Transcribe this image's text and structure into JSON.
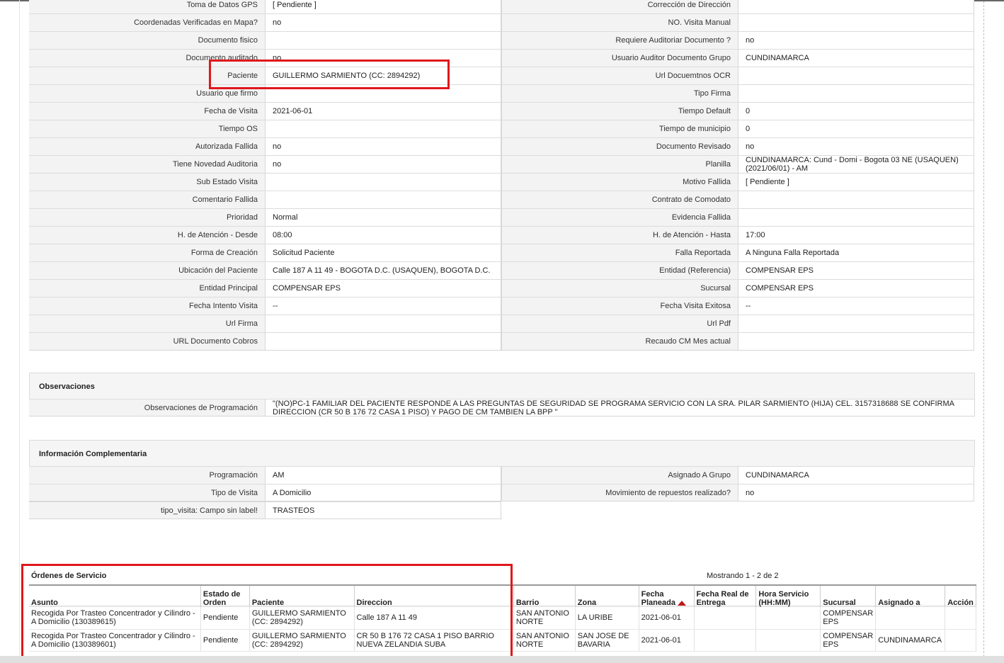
{
  "details": [
    {
      "l_label": "Toma de Datos GPS",
      "l_value": "[ Pendiente ]",
      "r_label": "Corrección de Dirección",
      "r_value": ""
    },
    {
      "l_label": "Coordenadas Verificadas en Mapa?",
      "l_value": "no",
      "r_label": "NO. Visita Manual",
      "r_value": ""
    },
    {
      "l_label": "Documento fisico",
      "l_value": "",
      "r_label": "Requiere Auditoriar Documento ?",
      "r_value": "no"
    },
    {
      "l_label": "Documento auditado",
      "l_value": "no",
      "r_label": "Usuario Auditor Documento Grupo",
      "r_value": "CUNDINAMARCA"
    },
    {
      "l_label": "Paciente",
      "l_value": "GUILLERMO SARMIENTO (CC: 2894292)",
      "r_label": "Url Docuemtnos OCR",
      "r_value": ""
    },
    {
      "l_label": "Usuario que firmo",
      "l_value": "",
      "r_label": "Tipo Firma",
      "r_value": ""
    },
    {
      "l_label": "Fecha de Visita",
      "l_value": "2021-06-01",
      "r_label": "Tiempo Default",
      "r_value": "0"
    },
    {
      "l_label": "Tiempo OS",
      "l_value": "",
      "r_label": "Tiempo de municipio",
      "r_value": "0"
    },
    {
      "l_label": "Autorizada Fallida",
      "l_value": "no",
      "r_label": "Documento Revisado",
      "r_value": "no"
    },
    {
      "l_label": "Tiene Novedad Auditoria",
      "l_value": "no",
      "r_label": "Planilla",
      "r_value": "CUNDINAMARCA: Cund - Domi - Bogota 03 NE (USAQUEN) (2021/06/01) - AM"
    },
    {
      "l_label": "Sub Estado Visita",
      "l_value": "",
      "r_label": "Motivo Fallida",
      "r_value": "[ Pendiente ]"
    },
    {
      "l_label": "Comentario Fallida",
      "l_value": "",
      "r_label": "Contrato de Comodato",
      "r_value": ""
    },
    {
      "l_label": "Prioridad",
      "l_value": "Normal",
      "r_label": "Evidencia Fallida",
      "r_value": ""
    },
    {
      "l_label": "H. de Atención - Desde",
      "l_value": "08:00",
      "r_label": "H. de Atención - Hasta",
      "r_value": "17:00"
    },
    {
      "l_label": "Forma de Creación",
      "l_value": "Solicitud Paciente",
      "r_label": "Falla Reportada",
      "r_value": "A Ninguna Falla Reportada"
    },
    {
      "l_label": "Ubicación del Paciente",
      "l_value": "Calle 187 A 11 49 - BOGOTA D.C. (USAQUEN), BOGOTA D.C.",
      "r_label": "Entidad (Referencia)",
      "r_value": "COMPENSAR EPS"
    },
    {
      "l_label": "Entidad Principal",
      "l_value": "COMPENSAR EPS",
      "r_label": "Sucursal",
      "r_value": "COMPENSAR EPS"
    },
    {
      "l_label": "Fecha Intento Visita",
      "l_value": "--",
      "r_label": "Fecha Visita Exitosa",
      "r_value": "--"
    },
    {
      "l_label": "Url Firma",
      "l_value": "",
      "r_label": "Url Pdf",
      "r_value": ""
    },
    {
      "l_label": "URL Documento Cobros",
      "l_value": "",
      "r_label": "Recaudo CM Mes actual",
      "r_value": ""
    }
  ],
  "observaciones": {
    "title": "Observaciones",
    "label": "Observaciones de Programación",
    "value": "\"(NO)PC-1 FAMILIAR DEL PACIENTE RESPONDE A LAS PREGUNTAS DE SEGURIDAD SE PROGRAMA SERVICIO CON LA SRA. PILAR SARMIENTO (HIJA) CEL. 3157318688 SE CONFIRMA DIRECCION (CR 50 B 176 72 CASA 1 PISO) Y PAGO DE CM TAMBIEN LA BPP \""
  },
  "complementaria": {
    "title": "Información Complementaria",
    "rows": [
      {
        "l_label": "Programación",
        "l_value": "AM",
        "r_label": "Asignado A Grupo",
        "r_value": "CUNDINAMARCA"
      },
      {
        "l_label": "Tipo de Visita",
        "l_value": "A Domicilio",
        "r_label": "Movimiento de repuestos realizado?",
        "r_value": "no"
      },
      {
        "l_label": "tipo_visita: Campo sin label!",
        "l_value": "TRASTEOS"
      }
    ]
  },
  "orders": {
    "title": "Órdenes de Servicio",
    "count": "Mostrando 1 - 2 de 2",
    "columns": {
      "asunto": "Asunto",
      "estado": "Estado de Orden",
      "paciente": "Paciente",
      "direccion": "Direccion",
      "barrio": "Barrio",
      "zona": "Zona",
      "fecha_planeada": "Fecha Planeada",
      "fecha_real": "Fecha Real de Entrega",
      "hora_servicio": "Hora Servicio (HH:MM)",
      "sucursal": "Sucursal",
      "asignado": "Asignado a",
      "accion": "Acción"
    },
    "rows": [
      {
        "asunto": "Recogida Por Trasteo Concentrador y Cilindro - A Domicilio (130389615)",
        "estado": "Pendiente",
        "paciente": "GUILLERMO SARMIENTO (CC: 2894292)",
        "direccion": "Calle 187 A 11 49",
        "barrio": "SAN ANTONIO NORTE",
        "zona": "LA URIBE",
        "fecha_planeada": "2021-06-01",
        "fecha_real": "",
        "hora_servicio": "",
        "sucursal": "COMPENSAR EPS",
        "asignado": "",
        "accion": ""
      },
      {
        "asunto": "Recogida Por Trasteo Concentrador y Cilindro - A Domicilio (130389601)",
        "estado": "Pendiente",
        "paciente": "GUILLERMO SARMIENTO (CC: 2894292)",
        "direccion": "CR 50 B 176 72 CASA 1 PISO BARRIO NUEVA ZELANDIA SUBA",
        "barrio": "SAN ANTONIO NORTE",
        "zona": "SAN JOSE DE BAVARIA",
        "fecha_planeada": "2021-06-01",
        "fecha_real": "",
        "hora_servicio": "",
        "sucursal": "COMPENSAR EPS",
        "asignado": "CUNDINAMARCA",
        "accion": ""
      }
    ]
  },
  "colors": {
    "highlight": "#e0171c",
    "sort_arrow": "#c0171a"
  }
}
